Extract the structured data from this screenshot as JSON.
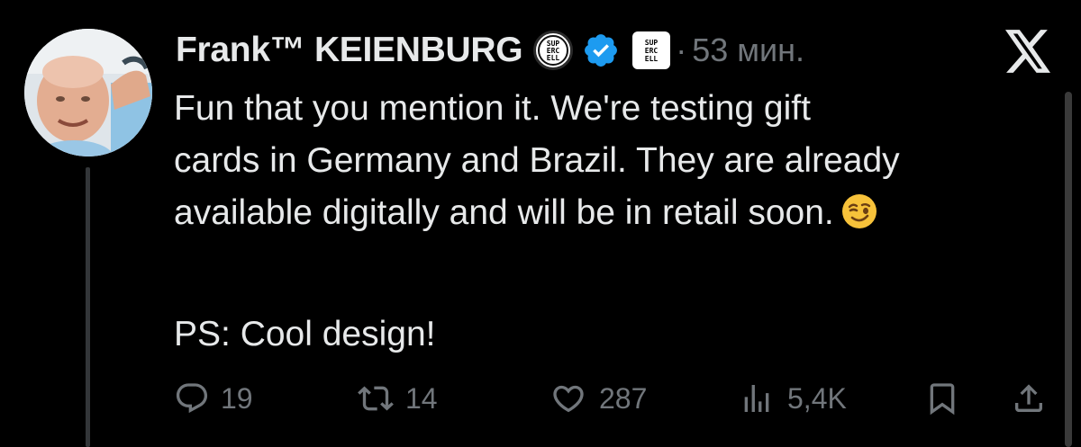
{
  "author": {
    "name": "Frank™ KEIENBURG",
    "badge_round_text": "SUP\nERC\nELL",
    "badge_square_text": "SUP\nERC\nELL",
    "verified": true,
    "time_separator": "·",
    "time": "53 мин."
  },
  "tweet": {
    "lines": [
      "Fun that you mention it. We're testing gift",
      "cards in Germany and Brazil. They are already",
      "available digitally and will be in retail soon."
    ],
    "ps": "PS: Cool design!"
  },
  "actions": {
    "replies": "19",
    "reposts": "14",
    "likes": "287",
    "views": "5,4K"
  },
  "colors": {
    "background": "#000000",
    "text": "#e7e9ea",
    "muted": "#71767b",
    "verified_blue": "#1d9bf0"
  },
  "icons": [
    "x-logo-icon",
    "verified-icon",
    "wink-emoji-icon",
    "reply-icon",
    "repost-icon",
    "like-icon",
    "views-icon",
    "bookmark-icon",
    "share-icon"
  ]
}
